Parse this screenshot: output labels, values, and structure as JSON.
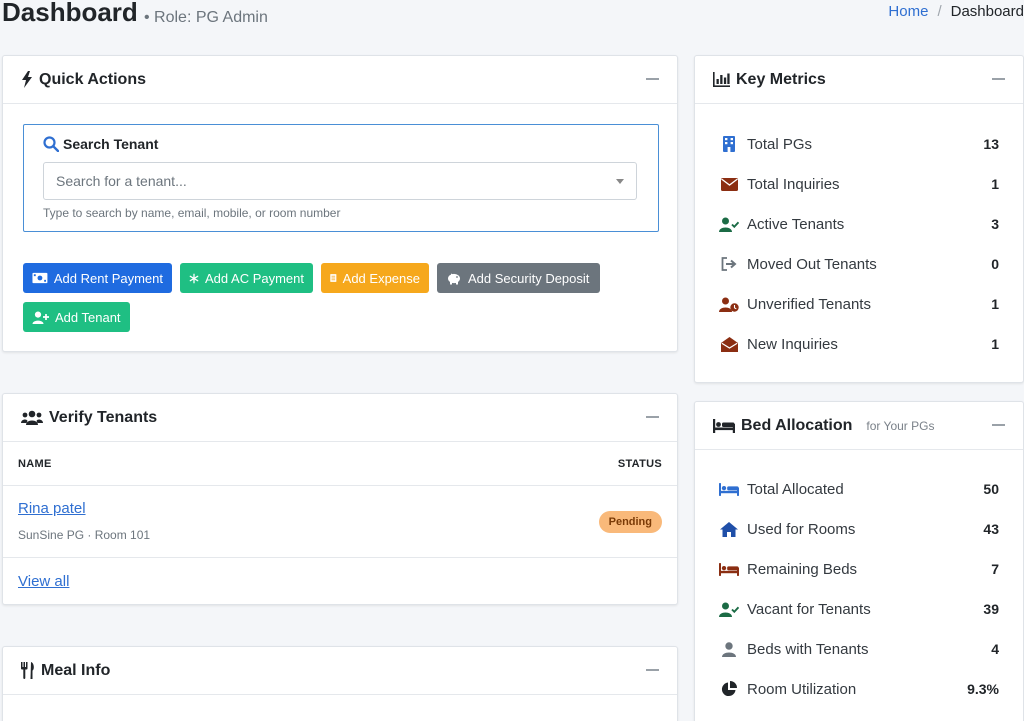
{
  "header": {
    "title": "Dashboard",
    "role": "• Role: PG Admin",
    "breadcrumb": {
      "home": "Home",
      "separator": "/",
      "current": "Dashboard"
    }
  },
  "quick_actions": {
    "title": "Quick Actions",
    "search": {
      "label": "Search Tenant",
      "placeholder": "Search for a tenant...",
      "help": "Type to search by name, email, mobile, or room number"
    },
    "buttons": {
      "add_rent_payment": "Add Rent Payment",
      "add_ac_payment": "Add AC Payment",
      "add_expense": "Add Expense",
      "add_security_deposit": "Add Security Deposit",
      "add_tenant": "Add Tenant"
    }
  },
  "verify_tenants": {
    "title": "Verify Tenants",
    "columns": {
      "name": "NAME",
      "status": "STATUS"
    },
    "rows": [
      {
        "name": "Rina patel",
        "detail": "SunSine PG · Room 101",
        "status": "Pending"
      }
    ],
    "view_all": "View all"
  },
  "meal_info": {
    "title": "Meal Info"
  },
  "key_metrics": {
    "title": "Key Metrics",
    "items": [
      {
        "label": "Total PGs",
        "value": "13",
        "icon": "building-icon",
        "color": "#2f6fd1"
      },
      {
        "label": "Total Inquiries",
        "value": "1",
        "icon": "envelope-icon",
        "color": "#8b2e12"
      },
      {
        "label": "Active Tenants",
        "value": "3",
        "icon": "user-check-icon",
        "color": "#1b6b45"
      },
      {
        "label": "Moved Out Tenants",
        "value": "0",
        "icon": "sign-out-icon",
        "color": "#6c757d"
      },
      {
        "label": "Unverified Tenants",
        "value": "1",
        "icon": "user-clock-icon",
        "color": "#8b2e12"
      },
      {
        "label": "New Inquiries",
        "value": "1",
        "icon": "envelope-open-icon",
        "color": "#8b2e12"
      }
    ]
  },
  "bed_allocation": {
    "title": "Bed Allocation",
    "subtitle": "for Your PGs",
    "items": [
      {
        "label": "Total Allocated",
        "value": "50",
        "icon": "bed-icon",
        "color": "#2f6fd1"
      },
      {
        "label": "Used for Rooms",
        "value": "43",
        "icon": "home-icon",
        "color": "#1f4fa8"
      },
      {
        "label": "Remaining Beds",
        "value": "7",
        "icon": "bed-icon",
        "color": "#8b2e12"
      },
      {
        "label": "Vacant for Tenants",
        "value": "39",
        "icon": "user-check-icon",
        "color": "#1b6b45"
      },
      {
        "label": "Beds with Tenants",
        "value": "4",
        "icon": "user-icon",
        "color": "#6c757d"
      },
      {
        "label": "Room Utilization",
        "value": "9.3%",
        "icon": "pie-chart-icon",
        "color": "#212529"
      }
    ]
  }
}
